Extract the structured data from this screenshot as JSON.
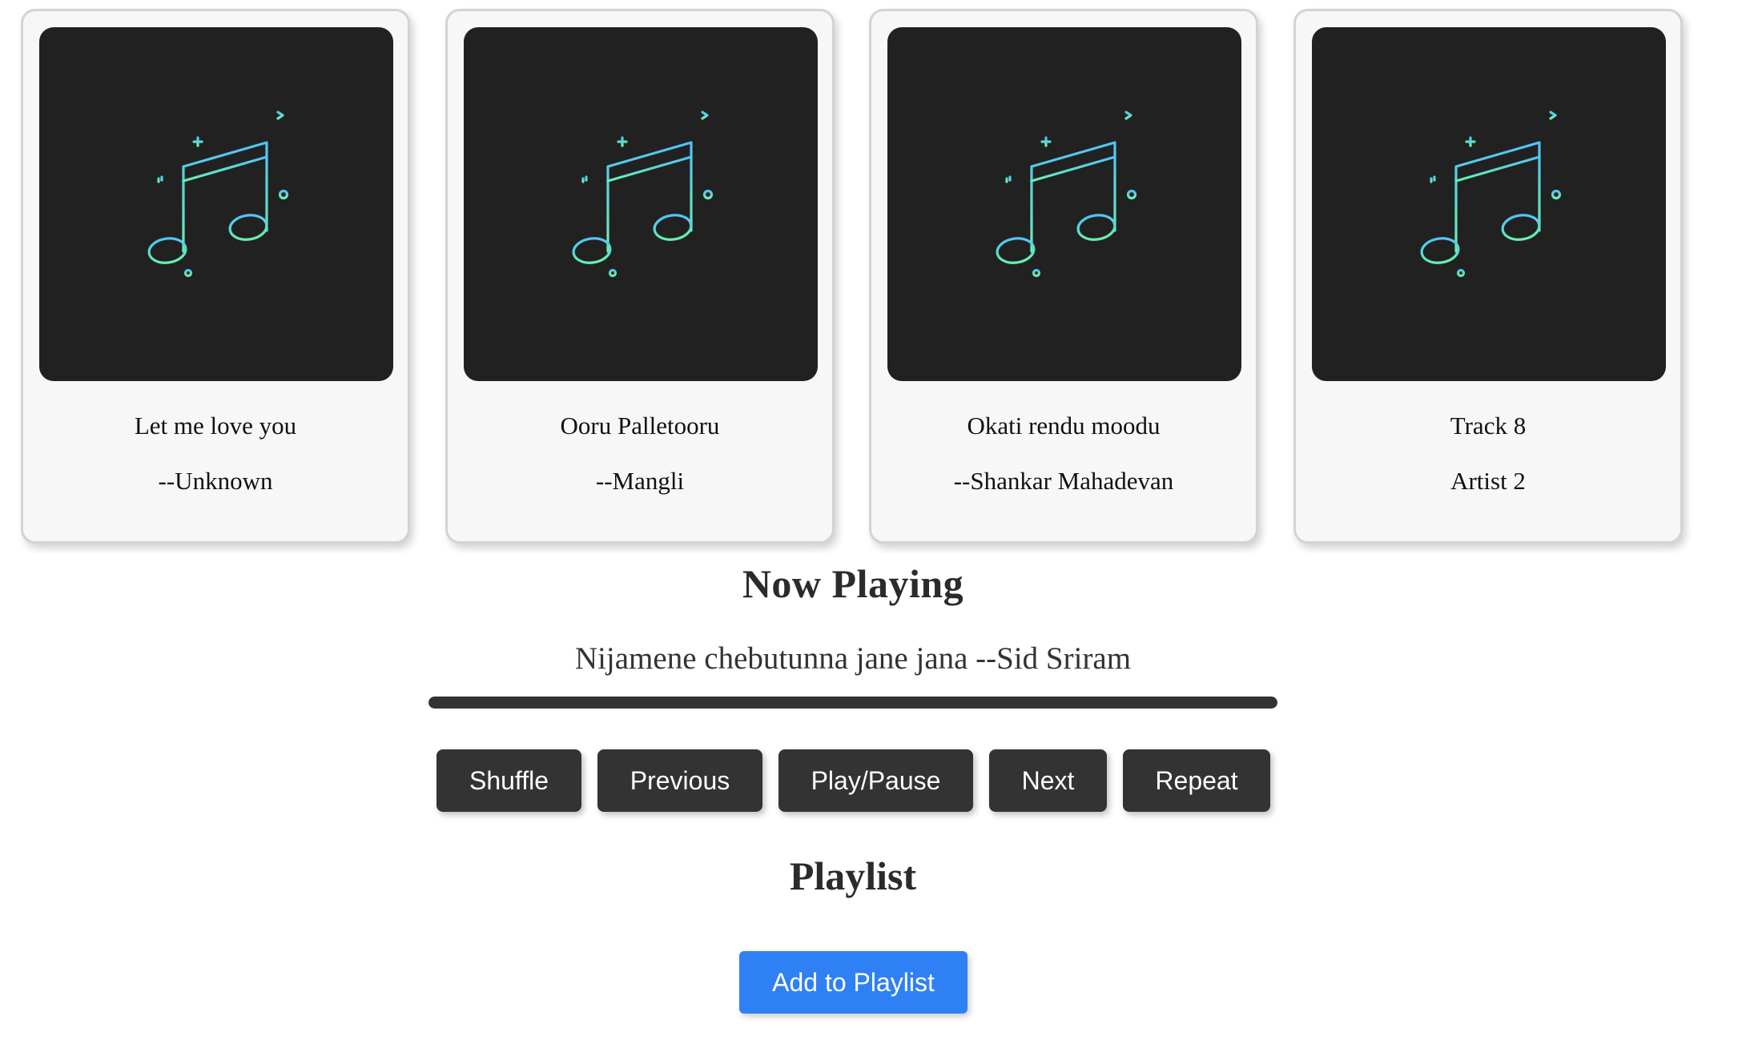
{
  "tracks": [
    {
      "title": "Let me love you",
      "artist": "--Unknown",
      "art_icon": "music-note-icon"
    },
    {
      "title": "Ooru Palletooru",
      "artist": "--Mangli",
      "art_icon": "music-note-icon"
    },
    {
      "title": "Okati rendu moodu",
      "artist": "--Shankar Mahadevan",
      "art_icon": "music-note-icon"
    },
    {
      "title": "Track 8",
      "artist": "Artist 2",
      "art_icon": "music-note-icon"
    }
  ],
  "now_playing": {
    "heading": "Now Playing",
    "track": "Nijamene chebutunna jane jana --Sid Sriram",
    "progress_percent": 100
  },
  "controls": {
    "shuffle": "Shuffle",
    "previous": "Previous",
    "play_pause": "Play/Pause",
    "next": "Next",
    "repeat": "Repeat"
  },
  "playlist": {
    "heading": "Playlist",
    "add_label": "Add to Playlist"
  },
  "colors": {
    "art_background": "#212121",
    "control_button": "#333333",
    "add_button": "#2f80f5",
    "icon_gradient_top": "#4fc3f7",
    "icon_gradient_bottom": "#69f0ae"
  }
}
